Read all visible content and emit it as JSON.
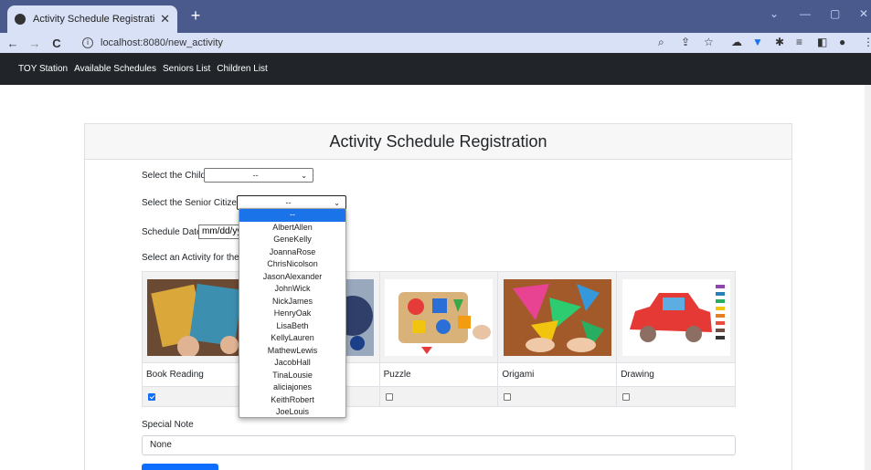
{
  "browser": {
    "tab_title": "Activity Schedule Registration",
    "tab_close": "✕",
    "new_tab": "+",
    "url": "localhost:8080/new_activity",
    "back": "←",
    "forward": "→",
    "reload": "C",
    "window_controls": [
      "⌄",
      "—",
      "▢",
      "✕"
    ]
  },
  "navbar": {
    "brand": "TOY Station",
    "links": [
      "Available Schedules",
      "Seniors List",
      "Children List"
    ]
  },
  "form": {
    "heading": "Activity Schedule Registration",
    "child_label": "Select the Child",
    "child_value": "--",
    "senior_label": "Select the Senior Citizen",
    "senior_value": "--",
    "date_label": "Schedule Date",
    "date_placeholder": "mm/dd/yy",
    "activity_label": "Select an Activity for the",
    "activities": [
      {
        "name": "Book Reading",
        "checked": true
      },
      {
        "name": "",
        "checked": false
      },
      {
        "name": "Puzzle",
        "checked": false
      },
      {
        "name": "Origami",
        "checked": false
      },
      {
        "name": "Drawing",
        "checked": false
      }
    ],
    "note_label": "Special Note",
    "note_value": "None"
  },
  "senior_dropdown": {
    "options": [
      "--",
      "AlbertAllen",
      "GeneKelly",
      "JoannaRose",
      "ChrisNicolson",
      "JasonAlexander",
      "JohnWick",
      "NickJames",
      "HenryOak",
      "LisaBeth",
      "KellyLauren",
      "MathewLewis",
      "JacobHall",
      "TinaLousie",
      "aliciajones",
      "KeithRobert",
      "JoeLouis"
    ],
    "selected": "--"
  },
  "colors": {
    "tabstrip": "#4a5a8c",
    "toolbar": "#d9e1f7",
    "navbar": "#212529",
    "accent": "#0d6efd",
    "dropdown_highlight": "#1a73e8"
  }
}
